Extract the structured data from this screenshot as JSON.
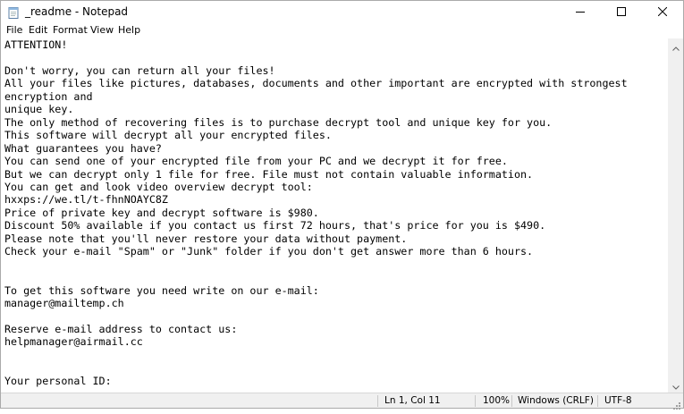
{
  "window": {
    "title": "_readme - Notepad",
    "app_icon": "notepad-icon",
    "controls": [
      "minimize-icon",
      "maximize-icon",
      "close-icon"
    ]
  },
  "menu": {
    "items": [
      "File",
      "Edit",
      "Format",
      "View",
      "Help"
    ]
  },
  "editor": {
    "content": "ATTENTION!\n\nDon't worry, you can return all your files!\nAll your files like pictures, databases, documents and other important are encrypted with strongest encryption and\nunique key.\nThe only method of recovering files is to purchase decrypt tool and unique key for you.\nThis software will decrypt all your encrypted files.\nWhat guarantees you have?\nYou can send one of your encrypted file from your PC and we decrypt it for free.\nBut we can decrypt only 1 file for free. File must not contain valuable information.\nYou can get and look video overview decrypt tool:\nhxxps://we.tl/t-fhnNOAYC8Z\nPrice of private key and decrypt software is $980.\nDiscount 50% available if you contact us first 72 hours, that's price for you is $490.\nPlease note that you'll never restore your data without payment.\nCheck your e-mail \"Spam\" or \"Junk\" folder if you don't get answer more than 6 hours.\n\n\nTo get this software you need write on our e-mail:\nmanager@mailtemp.ch\n\nReserve e-mail address to contact us:\nhelpmanager@airmail.cc\n\n\nYour personal ID:\n-"
  },
  "status": {
    "position": "Ln 1, Col 11",
    "zoom": "100%",
    "line_ending": "Windows (CRLF)",
    "encoding": "UTF-8"
  }
}
